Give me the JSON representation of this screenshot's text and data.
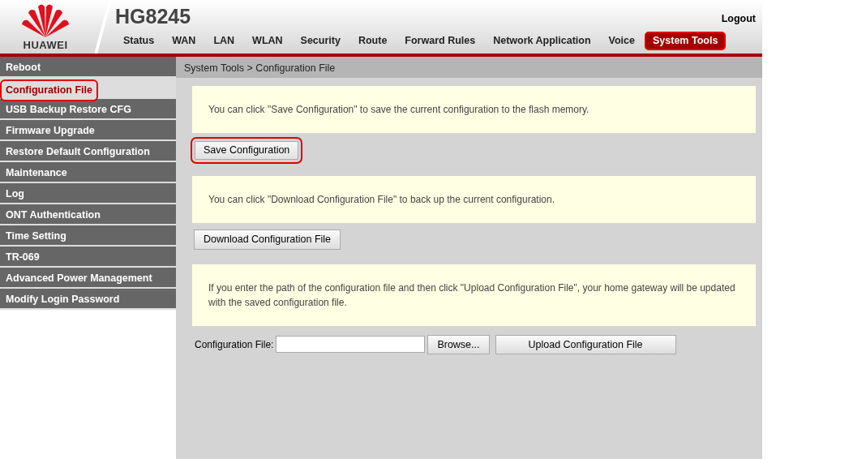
{
  "header": {
    "brand": "HUAWEI",
    "model": "HG8245",
    "logout": "Logout"
  },
  "tabs": [
    {
      "label": "Status",
      "selected": false,
      "highlighted": false
    },
    {
      "label": "WAN",
      "selected": false,
      "highlighted": false
    },
    {
      "label": "LAN",
      "selected": false,
      "highlighted": false
    },
    {
      "label": "WLAN",
      "selected": false,
      "highlighted": false
    },
    {
      "label": "Security",
      "selected": false,
      "highlighted": false
    },
    {
      "label": "Route",
      "selected": false,
      "highlighted": false
    },
    {
      "label": "Forward Rules",
      "selected": false,
      "highlighted": false
    },
    {
      "label": "Network Application",
      "selected": false,
      "highlighted": false
    },
    {
      "label": "Voice",
      "selected": false,
      "highlighted": false
    },
    {
      "label": "System Tools",
      "selected": true,
      "highlighted": true
    }
  ],
  "sidebar": {
    "items": [
      {
        "label": "Reboot",
        "selected": false,
        "highlighted": false
      },
      {
        "label": "Configuration File",
        "selected": true,
        "highlighted": true
      },
      {
        "label": "USB Backup Restore CFG",
        "selected": false,
        "highlighted": false
      },
      {
        "label": "Firmware Upgrade",
        "selected": false,
        "highlighted": false
      },
      {
        "label": "Restore Default Configuration",
        "selected": false,
        "highlighted": false
      },
      {
        "label": "Maintenance",
        "selected": false,
        "highlighted": false
      },
      {
        "label": "Log",
        "selected": false,
        "highlighted": false
      },
      {
        "label": "ONT Authentication",
        "selected": false,
        "highlighted": false
      },
      {
        "label": "Time Setting",
        "selected": false,
        "highlighted": false
      },
      {
        "label": "TR-069",
        "selected": false,
        "highlighted": false
      },
      {
        "label": "Advanced Power Management",
        "selected": false,
        "highlighted": false
      },
      {
        "label": "Modify Login Password",
        "selected": false,
        "highlighted": false
      }
    ]
  },
  "breadcrumb": "System Tools > Configuration File",
  "sections": [
    {
      "note": "You can click \"Save Configuration\" to save the current configuration to the flash memory.",
      "kind": "button",
      "button": "Save Configuration",
      "highlighted": true
    },
    {
      "note": "You can click \"Download Configuration File\" to back up the current configuration.",
      "kind": "button",
      "button": "Download Configuration File",
      "highlighted": false
    },
    {
      "note": "If you enter the path of the configuration file and then click \"Upload Configuration File\", your home gateway will be updated with the saved configuration file.",
      "kind": "upload",
      "field_label": "Configuration File:",
      "browse": "Browse...",
      "button": "Upload Configuration File",
      "highlighted": false
    }
  ]
}
